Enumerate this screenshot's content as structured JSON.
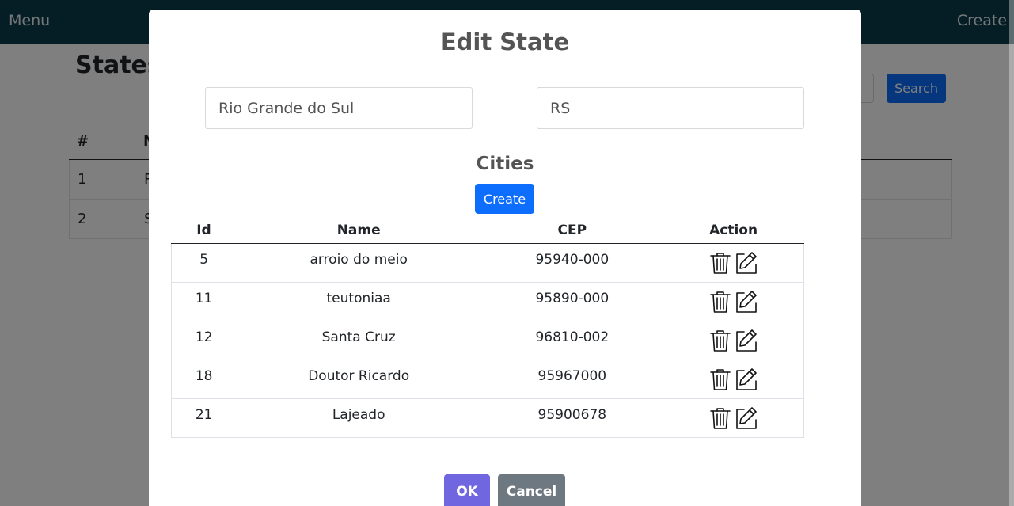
{
  "navbar": {
    "menu_label": "Menu",
    "create_label": "Create"
  },
  "page": {
    "title": "States",
    "search_label": "Search",
    "table_headers": [
      "#",
      "N"
    ],
    "rows": [
      {
        "index": "1",
        "name_initial": "R"
      },
      {
        "index": "2",
        "name_initial": "S"
      }
    ]
  },
  "modal": {
    "title": "Edit State",
    "name_value": "Rio Grande do Sul",
    "abbr_value": "RS",
    "cities_title": "Cities",
    "create_label": "Create",
    "columns": {
      "id": "Id",
      "name": "Name",
      "cep": "CEP",
      "action": "Action"
    },
    "cities": [
      {
        "id": "5",
        "name": "arroio do meio",
        "cep": "95940-000"
      },
      {
        "id": "11",
        "name": "teutoniaa",
        "cep": "95890-000"
      },
      {
        "id": "12",
        "name": "Santa Cruz",
        "cep": "96810-002"
      },
      {
        "id": "18",
        "name": "Doutor Ricardo",
        "cep": "95967000"
      },
      {
        "id": "21",
        "name": "Lajeado",
        "cep": "95900678"
      }
    ],
    "action_icons": [
      "trash-icon",
      "edit-icon"
    ],
    "ok_label": "OK",
    "cancel_label": "Cancel"
  },
  "colors": {
    "navbar": "#0b3d4d",
    "primary": "#0d6efd",
    "confirm": "#7066e0",
    "cancel": "#6e7881"
  }
}
